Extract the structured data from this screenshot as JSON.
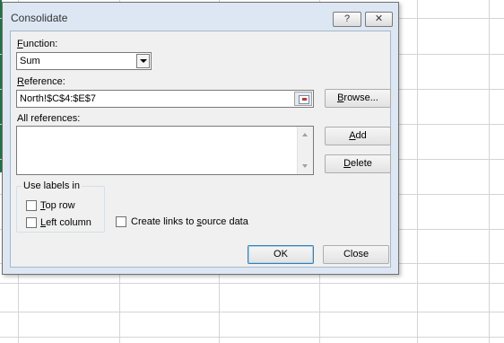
{
  "dialog": {
    "title": "Consolidate",
    "help_glyph": "?",
    "close_glyph": "✕"
  },
  "function": {
    "label": "Function:",
    "label_hotkey": "F",
    "label_rest": "unction:",
    "value": "Sum"
  },
  "reference": {
    "label_hotkey": "R",
    "label_rest": "eference:",
    "value": "North!$C$4:$E$7"
  },
  "buttons": {
    "browse_hotkey": "B",
    "browse_rest": "rowse...",
    "add_hotkey": "A",
    "add_rest": "dd",
    "delete_hotkey": "D",
    "delete_rest": "elete",
    "ok": "OK",
    "close": "Close"
  },
  "all_references": {
    "label": "All references:",
    "items": []
  },
  "use_labels": {
    "title": "Use labels in",
    "top_row_hotkey": "T",
    "top_row_rest": "op row",
    "top_row_checked": false,
    "left_column_hotkey": "L",
    "left_column_rest": "eft column",
    "left_column_checked": false
  },
  "links": {
    "pre": "Create links to ",
    "hotkey": "s",
    "post": "ource data",
    "checked": false
  },
  "colors": {
    "accent_green": "#217346",
    "dialog_frame": "#dde7f3"
  }
}
